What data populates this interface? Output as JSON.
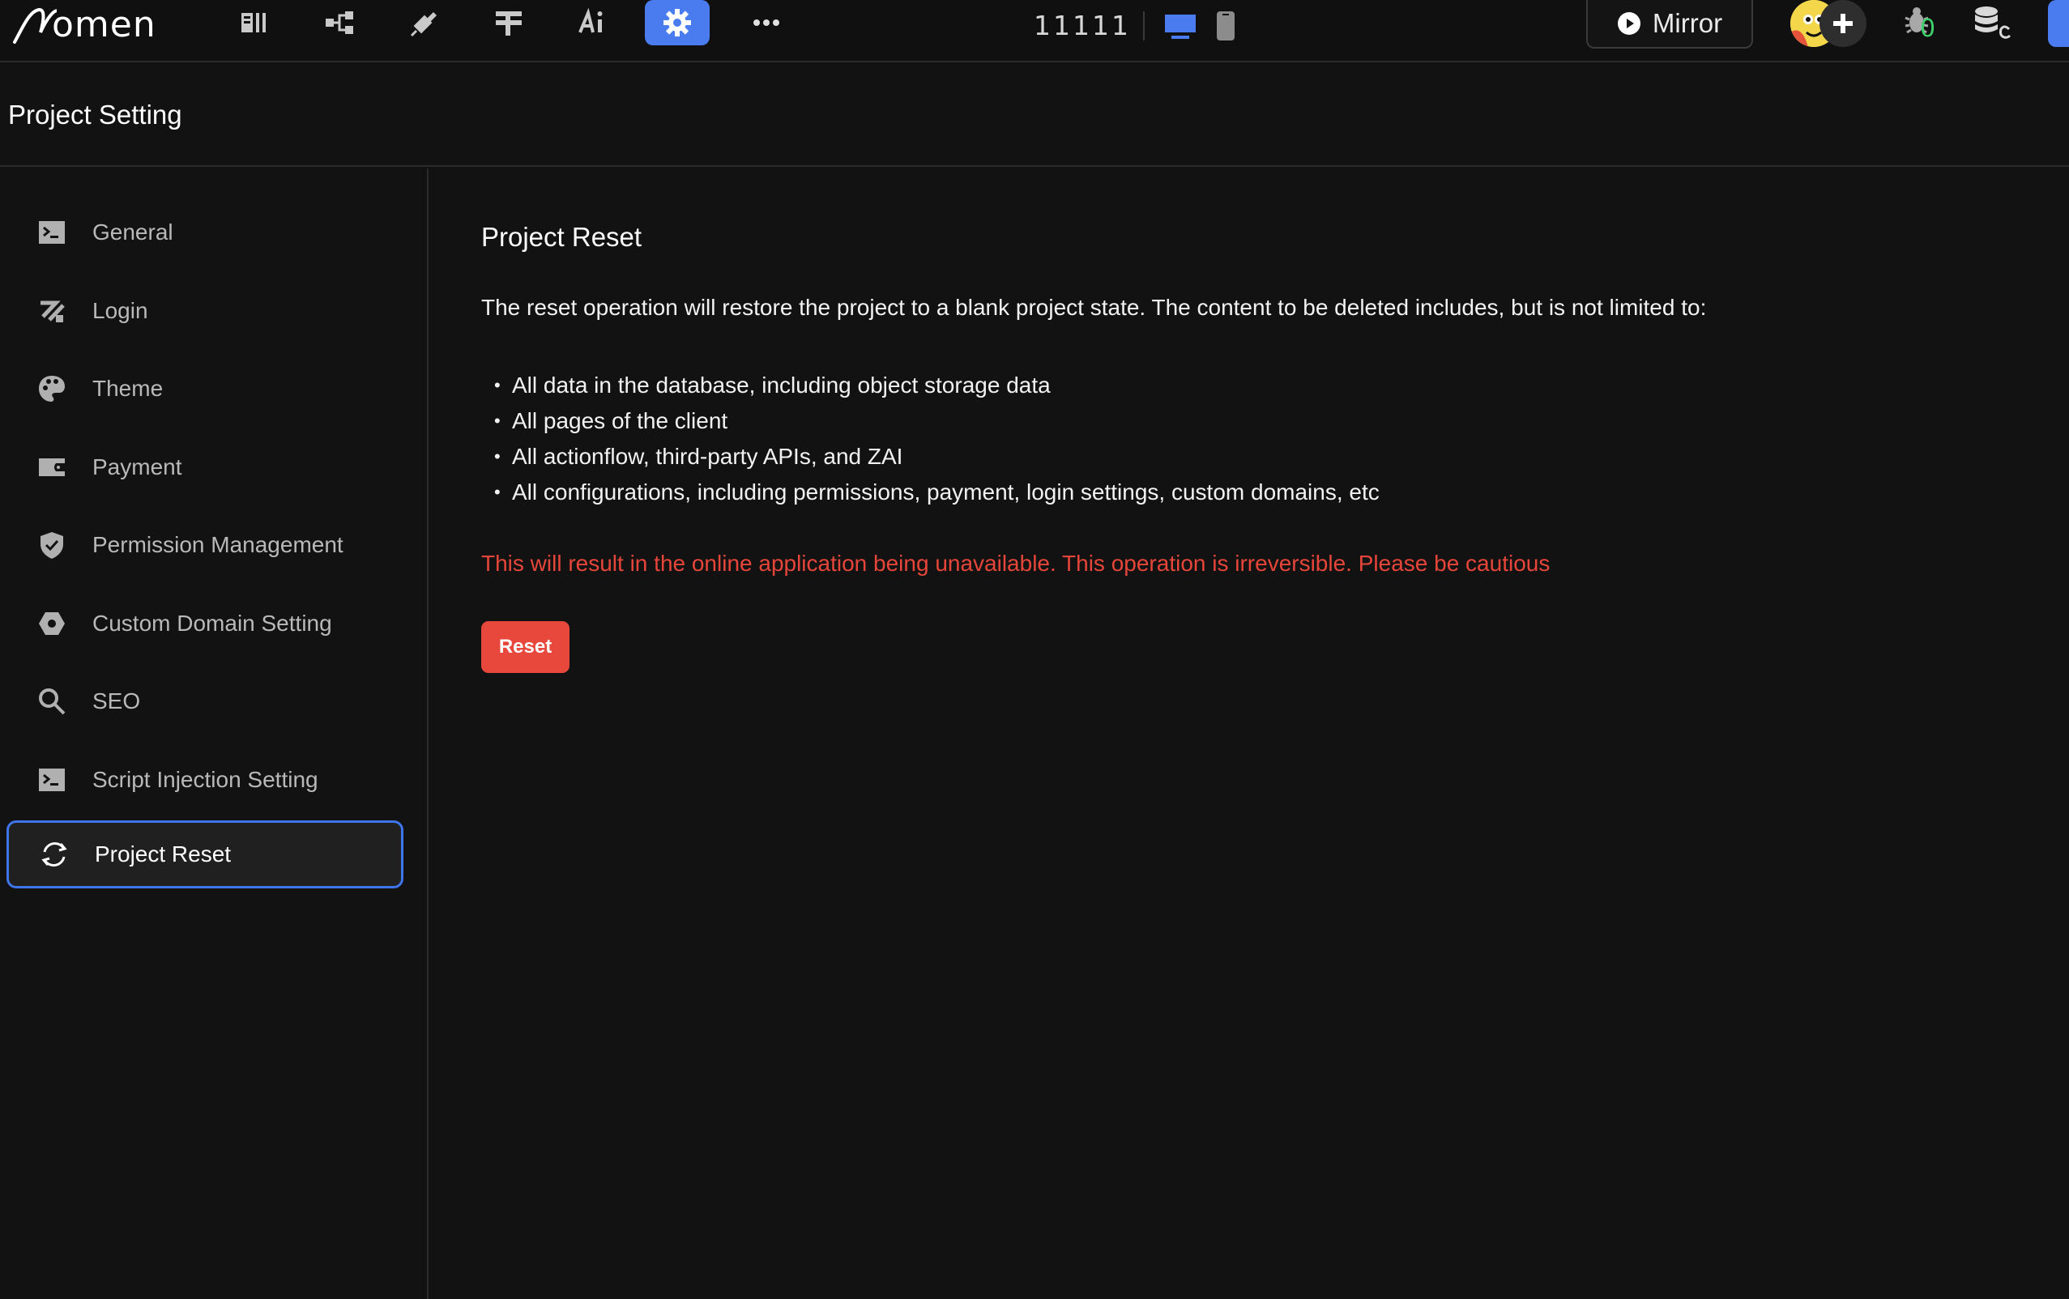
{
  "topbar": {
    "brand": "omen",
    "project_name": "11111",
    "mirror_label": "Mirror",
    "debug_count": "0",
    "tools": [
      "components-icon",
      "flow-icon",
      "plugin-icon",
      "data-icon",
      "ai-icon",
      "settings-icon",
      "more-icon"
    ]
  },
  "page": {
    "title": "Project Setting"
  },
  "sidebar": {
    "items": [
      {
        "label": "General",
        "icon": "terminal-icon"
      },
      {
        "label": "Login",
        "icon": "login-icon"
      },
      {
        "label": "Theme",
        "icon": "palette-icon"
      },
      {
        "label": "Payment",
        "icon": "wallet-icon"
      },
      {
        "label": "Permission Management",
        "icon": "shield-icon"
      },
      {
        "label": "Custom Domain Setting",
        "icon": "domain-icon"
      },
      {
        "label": "SEO",
        "icon": "search-icon"
      },
      {
        "label": "Script Injection Setting",
        "icon": "terminal-icon"
      },
      {
        "label": "Project Reset",
        "icon": "refresh-icon",
        "active": true
      }
    ]
  },
  "main": {
    "title": "Project Reset",
    "description": "The reset operation will restore the project to a blank project state. The content to be deleted includes, but is not limited to:",
    "bullets": [
      "All data in the database, including object storage data",
      "All pages of the client",
      "All actionflow, third-party APIs, and ZAI",
      "All configurations, including permissions, payment, login settings, custom domains, etc"
    ],
    "warning": "This will result in the online application being unavailable. This operation is irreversible. Please be cautious",
    "reset_label": "Reset"
  },
  "colors": {
    "accent": "#4a7cf0",
    "danger": "#e8473c",
    "background": "#121212"
  }
}
